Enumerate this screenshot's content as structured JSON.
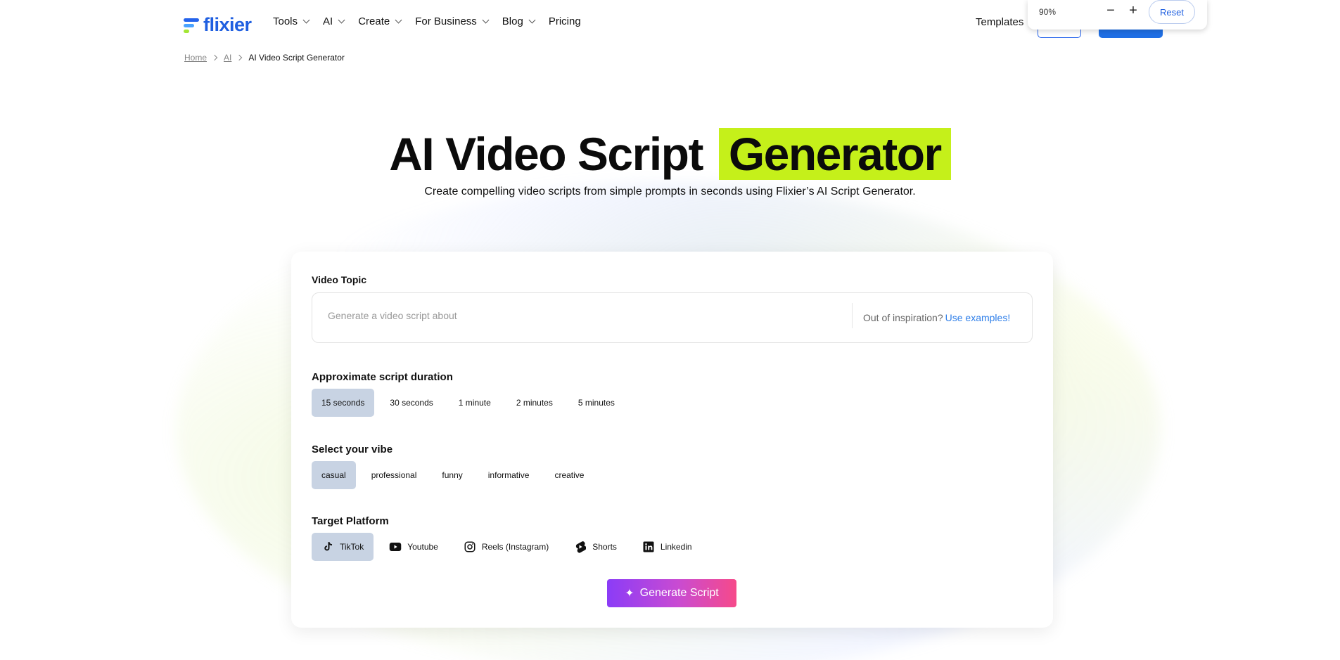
{
  "nav": {
    "logo": "flixier",
    "menu": [
      {
        "label": "Tools",
        "dropdown": true
      },
      {
        "label": "AI",
        "dropdown": true
      },
      {
        "label": "Create",
        "dropdown": true
      },
      {
        "label": "For Business",
        "dropdown": true
      },
      {
        "label": "Blog",
        "dropdown": true
      },
      {
        "label": "Pricing",
        "dropdown": false
      }
    ],
    "templates": "Templates"
  },
  "zoom": {
    "value": "90%",
    "minus": "−",
    "plus": "+",
    "reset": "Reset"
  },
  "breadcrumb": {
    "home": "Home",
    "ai": "AI",
    "current": "AI Video Script Generator"
  },
  "hero": {
    "title_part1": "AI Video Script",
    "title_highlight": "Generator",
    "subtitle": "Create compelling video scripts from simple prompts in seconds using Flixier’s AI Script Generator.",
    "highlight_color": "#c5f01a"
  },
  "form": {
    "topic_label": "Video Topic",
    "topic_placeholder": "Generate a video script about",
    "topic_value": "",
    "inspiration_text": "Out of inspiration?",
    "inspiration_link": "Use examples!",
    "duration_label": "Approximate script duration",
    "durations": [
      "15 seconds",
      "30 seconds",
      "1 minute",
      "2 minutes",
      "5 minutes"
    ],
    "duration_selected": "15 seconds",
    "vibe_label": "Select your vibe",
    "vibes": [
      "casual",
      "professional",
      "funny",
      "informative",
      "creative"
    ],
    "vibe_selected": "casual",
    "platform_label": "Target Platform",
    "platforms": [
      {
        "label": "TikTok",
        "icon": "tiktok-icon"
      },
      {
        "label": "Youtube",
        "icon": "youtube-icon"
      },
      {
        "label": "Reels (Instagram)",
        "icon": "instagram-icon"
      },
      {
        "label": "Shorts",
        "icon": "shorts-icon"
      },
      {
        "label": "Linkedin",
        "icon": "linkedin-icon"
      }
    ],
    "platform_selected": "TikTok",
    "generate_label": "Generate Script",
    "generate_icon": "sparkles-icon"
  }
}
